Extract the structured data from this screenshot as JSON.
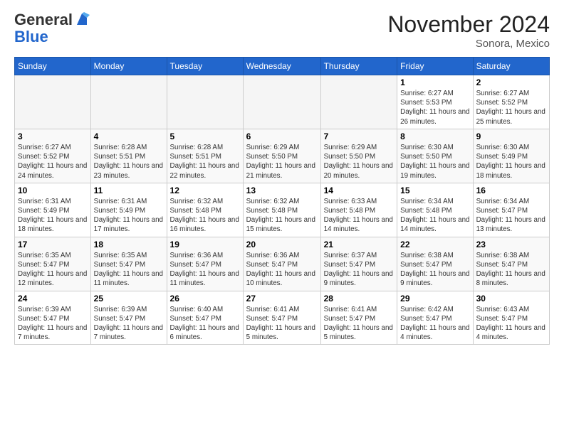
{
  "header": {
    "logo_general": "General",
    "logo_blue": "Blue",
    "month_title": "November 2024",
    "location": "Sonora, Mexico"
  },
  "calendar": {
    "days_of_week": [
      "Sunday",
      "Monday",
      "Tuesday",
      "Wednesday",
      "Thursday",
      "Friday",
      "Saturday"
    ],
    "weeks": [
      [
        {
          "day": "",
          "info": ""
        },
        {
          "day": "",
          "info": ""
        },
        {
          "day": "",
          "info": ""
        },
        {
          "day": "",
          "info": ""
        },
        {
          "day": "",
          "info": ""
        },
        {
          "day": "1",
          "info": "Sunrise: 6:27 AM\nSunset: 5:53 PM\nDaylight: 11 hours and 26 minutes."
        },
        {
          "day": "2",
          "info": "Sunrise: 6:27 AM\nSunset: 5:52 PM\nDaylight: 11 hours and 25 minutes."
        }
      ],
      [
        {
          "day": "3",
          "info": "Sunrise: 6:27 AM\nSunset: 5:52 PM\nDaylight: 11 hours and 24 minutes."
        },
        {
          "day": "4",
          "info": "Sunrise: 6:28 AM\nSunset: 5:51 PM\nDaylight: 11 hours and 23 minutes."
        },
        {
          "day": "5",
          "info": "Sunrise: 6:28 AM\nSunset: 5:51 PM\nDaylight: 11 hours and 22 minutes."
        },
        {
          "day": "6",
          "info": "Sunrise: 6:29 AM\nSunset: 5:50 PM\nDaylight: 11 hours and 21 minutes."
        },
        {
          "day": "7",
          "info": "Sunrise: 6:29 AM\nSunset: 5:50 PM\nDaylight: 11 hours and 20 minutes."
        },
        {
          "day": "8",
          "info": "Sunrise: 6:30 AM\nSunset: 5:50 PM\nDaylight: 11 hours and 19 minutes."
        },
        {
          "day": "9",
          "info": "Sunrise: 6:30 AM\nSunset: 5:49 PM\nDaylight: 11 hours and 18 minutes."
        }
      ],
      [
        {
          "day": "10",
          "info": "Sunrise: 6:31 AM\nSunset: 5:49 PM\nDaylight: 11 hours and 18 minutes."
        },
        {
          "day": "11",
          "info": "Sunrise: 6:31 AM\nSunset: 5:49 PM\nDaylight: 11 hours and 17 minutes."
        },
        {
          "day": "12",
          "info": "Sunrise: 6:32 AM\nSunset: 5:48 PM\nDaylight: 11 hours and 16 minutes."
        },
        {
          "day": "13",
          "info": "Sunrise: 6:32 AM\nSunset: 5:48 PM\nDaylight: 11 hours and 15 minutes."
        },
        {
          "day": "14",
          "info": "Sunrise: 6:33 AM\nSunset: 5:48 PM\nDaylight: 11 hours and 14 minutes."
        },
        {
          "day": "15",
          "info": "Sunrise: 6:34 AM\nSunset: 5:48 PM\nDaylight: 11 hours and 14 minutes."
        },
        {
          "day": "16",
          "info": "Sunrise: 6:34 AM\nSunset: 5:47 PM\nDaylight: 11 hours and 13 minutes."
        }
      ],
      [
        {
          "day": "17",
          "info": "Sunrise: 6:35 AM\nSunset: 5:47 PM\nDaylight: 11 hours and 12 minutes."
        },
        {
          "day": "18",
          "info": "Sunrise: 6:35 AM\nSunset: 5:47 PM\nDaylight: 11 hours and 11 minutes."
        },
        {
          "day": "19",
          "info": "Sunrise: 6:36 AM\nSunset: 5:47 PM\nDaylight: 11 hours and 11 minutes."
        },
        {
          "day": "20",
          "info": "Sunrise: 6:36 AM\nSunset: 5:47 PM\nDaylight: 11 hours and 10 minutes."
        },
        {
          "day": "21",
          "info": "Sunrise: 6:37 AM\nSunset: 5:47 PM\nDaylight: 11 hours and 9 minutes."
        },
        {
          "day": "22",
          "info": "Sunrise: 6:38 AM\nSunset: 5:47 PM\nDaylight: 11 hours and 9 minutes."
        },
        {
          "day": "23",
          "info": "Sunrise: 6:38 AM\nSunset: 5:47 PM\nDaylight: 11 hours and 8 minutes."
        }
      ],
      [
        {
          "day": "24",
          "info": "Sunrise: 6:39 AM\nSunset: 5:47 PM\nDaylight: 11 hours and 7 minutes."
        },
        {
          "day": "25",
          "info": "Sunrise: 6:39 AM\nSunset: 5:47 PM\nDaylight: 11 hours and 7 minutes."
        },
        {
          "day": "26",
          "info": "Sunrise: 6:40 AM\nSunset: 5:47 PM\nDaylight: 11 hours and 6 minutes."
        },
        {
          "day": "27",
          "info": "Sunrise: 6:41 AM\nSunset: 5:47 PM\nDaylight: 11 hours and 5 minutes."
        },
        {
          "day": "28",
          "info": "Sunrise: 6:41 AM\nSunset: 5:47 PM\nDaylight: 11 hours and 5 minutes."
        },
        {
          "day": "29",
          "info": "Sunrise: 6:42 AM\nSunset: 5:47 PM\nDaylight: 11 hours and 4 minutes."
        },
        {
          "day": "30",
          "info": "Sunrise: 6:43 AM\nSunset: 5:47 PM\nDaylight: 11 hours and 4 minutes."
        }
      ]
    ]
  }
}
